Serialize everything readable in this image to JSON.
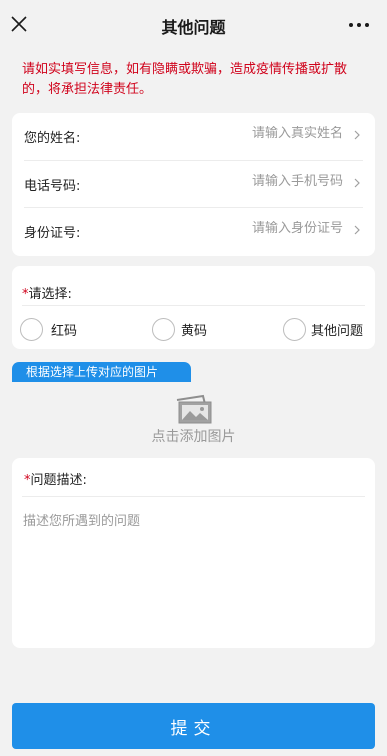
{
  "header": {
    "title": "其他问题",
    "close_icon": "close-icon",
    "more_icon": "more-dots-icon"
  },
  "notice": "请如实填写信息，如有隐瞒或欺骗，造成疫情传播或扩散的，将承担法律责任。",
  "info_fields": [
    {
      "label": "您的姓名:",
      "placeholder": "请输入真实姓名",
      "value": ""
    },
    {
      "label": "电话号码:",
      "placeholder": "请输入手机号码",
      "value": ""
    },
    {
      "label": "身份证号:",
      "placeholder": "请输入身份证号",
      "value": ""
    }
  ],
  "choice": {
    "required_mark": "*",
    "label": "请选择:",
    "options": [
      "红码",
      "黄码",
      "其他问题"
    ],
    "selected": ""
  },
  "upload": {
    "tag": "根据选择上传对应的图片",
    "hint": "点击添加图片",
    "icon": "photo-icon"
  },
  "description": {
    "required_mark": "*",
    "label": "问题描述:",
    "placeholder": "描述您所遇到的问题",
    "value": ""
  },
  "submit_label": "提交",
  "colors": {
    "accent": "#1f8fe8",
    "warning": "#d0021b",
    "background": "#f2f2f2"
  }
}
